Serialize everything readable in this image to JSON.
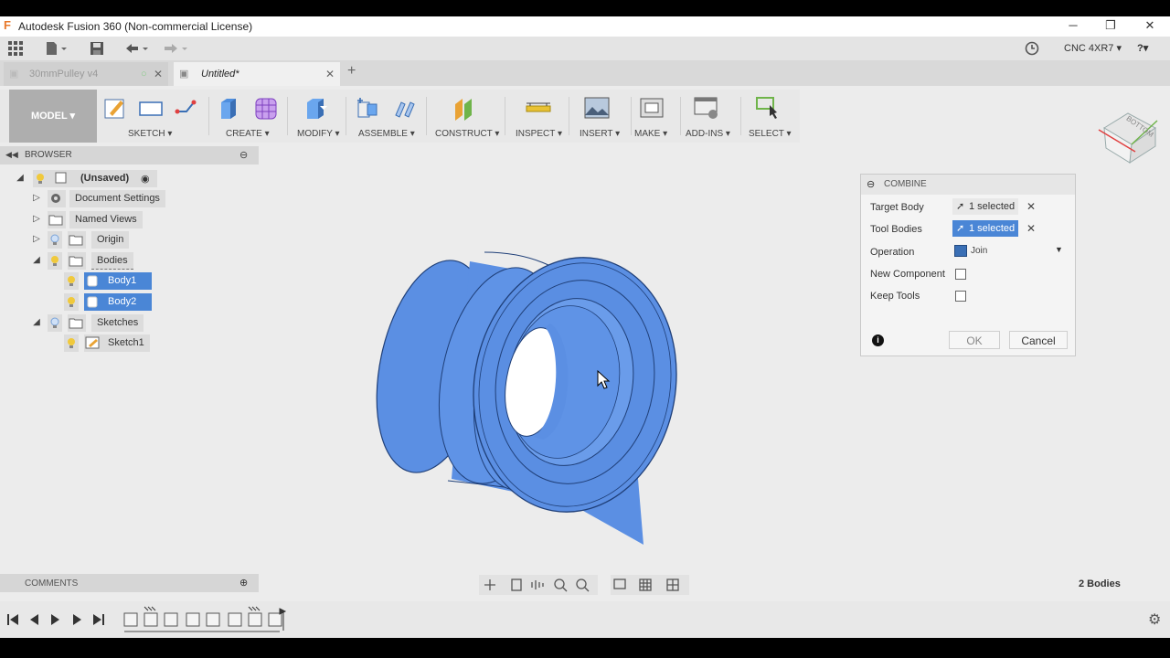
{
  "window": {
    "title": "Autodesk Fusion 360 (Non-commercial License)",
    "minimize": "─",
    "restore": "❐",
    "close": "✕"
  },
  "qat": {
    "account": "CNC 4XR7 ▾",
    "help": "?▾"
  },
  "tabs": [
    {
      "label": "30mmPulley v4",
      "active": false
    },
    {
      "label": "Untitled*",
      "active": true
    }
  ],
  "tab_close": "✕",
  "tab_add": "+",
  "ribbon": {
    "workspace": "MODEL ▾",
    "groups": [
      "SKETCH ▾",
      "CREATE ▾",
      "MODIFY ▾",
      "ASSEMBLE ▾",
      "CONSTRUCT ▾",
      "INSPECT ▾",
      "INSERT ▾",
      "MAKE ▾",
      "ADD-INS ▾",
      "SELECT ▾"
    ]
  },
  "browser": {
    "title": "BROWSER",
    "items": [
      {
        "label": "(Unsaved)"
      },
      {
        "label": "Document Settings"
      },
      {
        "label": "Named Views"
      },
      {
        "label": "Origin"
      },
      {
        "label": "Bodies"
      },
      {
        "label": "Body1"
      },
      {
        "label": "Body2"
      },
      {
        "label": "Sketches"
      },
      {
        "label": "Sketch1"
      }
    ]
  },
  "combine": {
    "title": "COMBINE",
    "target_label": "Target Body",
    "target_value": "1 selected",
    "tool_label": "Tool Bodies",
    "tool_value": "1 selected",
    "operation_label": "Operation",
    "operation_value": "Join",
    "new_component_label": "New Component",
    "keep_tools_label": "Keep Tools",
    "ok": "OK",
    "cancel": "Cancel",
    "remove": "✕"
  },
  "viewcube_label": "BOTTOM",
  "comments": {
    "title": "COMMENTS"
  },
  "status": {
    "bodies": "2 Bodies"
  },
  "colors": {
    "accent": "#4a86d6",
    "body": "#5b8fe3",
    "model_button": "#aeaeae"
  }
}
